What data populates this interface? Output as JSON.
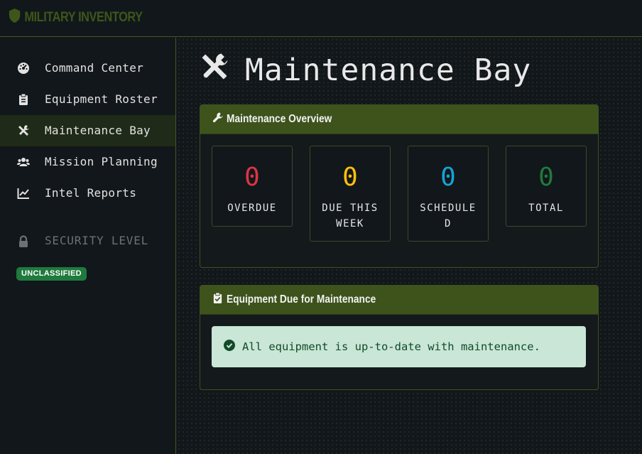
{
  "brand": {
    "title": "MILITARY INVENTORY",
    "icon": "shield-icon"
  },
  "sidebar": {
    "items": [
      {
        "label": "Command Center",
        "icon": "gauge-icon",
        "active": false
      },
      {
        "label": "Equipment Roster",
        "icon": "clipboard-icon",
        "active": false
      },
      {
        "label": "Maintenance Bay",
        "icon": "tools-icon",
        "active": true
      },
      {
        "label": "Mission Planning",
        "icon": "users-icon",
        "active": false
      },
      {
        "label": "Intel Reports",
        "icon": "chart-line-icon",
        "active": false
      }
    ],
    "security": {
      "label": "SECURITY LEVEL",
      "icon": "lock-icon",
      "badge": "UNCLASSIFIED"
    }
  },
  "main": {
    "title": "Maintenance Bay",
    "title_icon": "tools-icon",
    "overview": {
      "heading": "Maintenance Overview",
      "icon": "wrench-icon",
      "stats": [
        {
          "value": "0",
          "caption": "OVERDUE",
          "color": "#dc3545"
        },
        {
          "value": "0",
          "caption": "DUE THIS WEEK",
          "color": "#ffc107"
        },
        {
          "value": "0",
          "caption": "SCHEDULED",
          "color": "#17a2d8"
        },
        {
          "value": "0",
          "caption": "TOTAL",
          "color": "#1f7a3d"
        }
      ]
    },
    "due": {
      "heading": "Equipment Due for Maintenance",
      "icon": "clipboard-check-icon",
      "message": "All equipment is up-to-date with maintenance.",
      "message_icon": "check-circle-icon"
    }
  },
  "colors": {
    "accent": "#3e531c",
    "background": "#12171b",
    "badge": "#1f7a3d",
    "success_bg": "#c9e6d6"
  }
}
